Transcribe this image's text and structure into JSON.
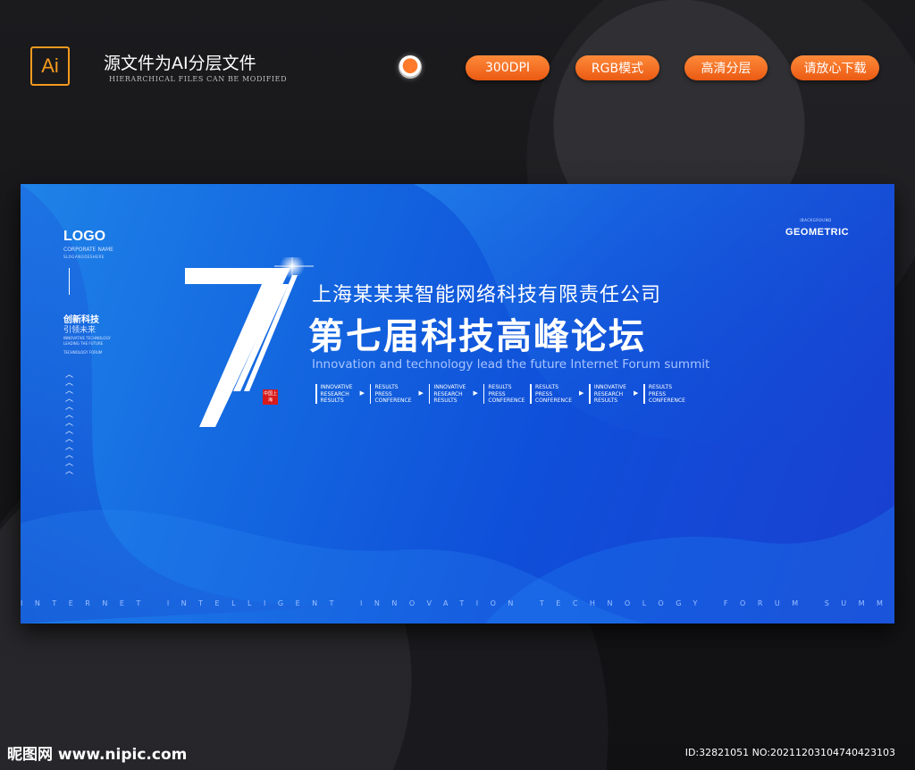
{
  "header": {
    "ai_label": "Ai",
    "title": "源文件为AI分层文件",
    "subtitle": "HIERARCHICAL FILES CAN BE MODIFIED",
    "pills": [
      "300DPI",
      "RGB模式",
      "高清分层",
      "请放心下载"
    ]
  },
  "banner": {
    "logo": "LOGO",
    "corporate_name": "CORPORATE NAME",
    "corporate_slogan": "SLOGANGOESHERE",
    "left_title": "创新科技",
    "left_subtitle": "引领未来",
    "left_tiny_1": "INNOVATIVE TECHNOLOGY",
    "left_tiny_2": "LEADING THE FUTURE",
    "left_tiny_3": "TECHNOLOGY FORUM",
    "geo_small": "/BACKGROUND",
    "geo": "GEOMETRIC",
    "seal": "中国上海",
    "company": "上海某某某智能网络科技有限责任公司",
    "title": "第七届科技高峰论坛",
    "subtitle": "Innovation and technology lead the future Internet Forum summit",
    "tags": [
      [
        "INNOVATIVE",
        "RESEARCH",
        "RESULTS"
      ],
      [
        "RESULTS",
        "PRESS",
        "CONFERENCE"
      ],
      [
        "INNOVATIVE",
        "RESEARCH",
        "RESULTS"
      ],
      [
        "RESULTS",
        "PRESS",
        "CONFERENCE"
      ],
      [
        "RESULTS",
        "PRESS",
        "CONFERENCE"
      ],
      [
        "INNOVATIVE",
        "RESEARCH",
        "RESULTS"
      ],
      [
        "RESULTS",
        "PRESS",
        "CONFERENCE"
      ]
    ],
    "bottom_text": "INTERNET INTELLIGENT INNOVATION TECHNOLOGY FORUM SUMMIT"
  },
  "footer": {
    "brand": "昵图网 www.nipic.com",
    "id": "ID:32821051 NO:20211203104740423103"
  },
  "colors": {
    "accent_orange": "#ea5a12",
    "banner_blue": "#1468e0",
    "ai_orange": "#f59a1e"
  }
}
